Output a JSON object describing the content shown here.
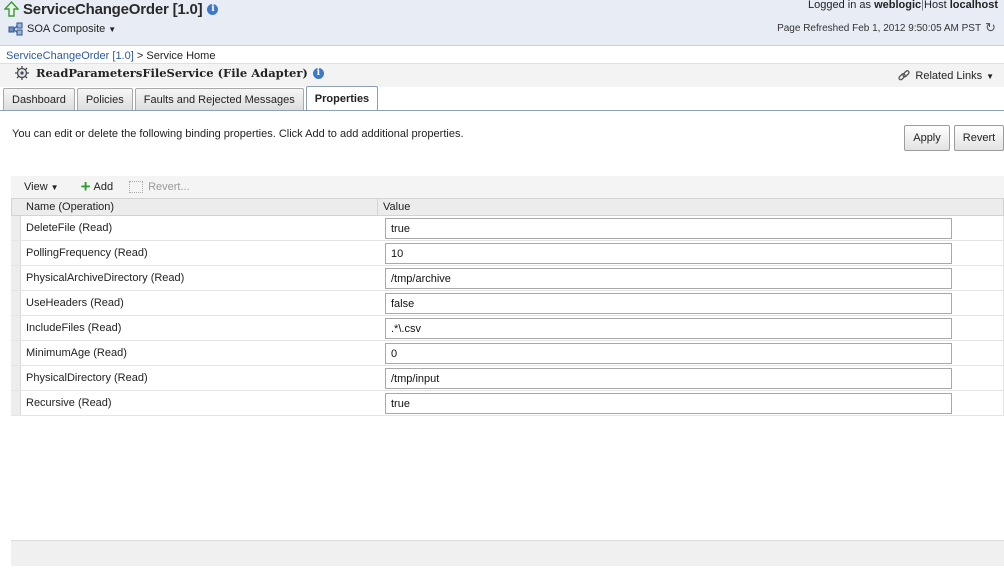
{
  "header": {
    "title": "ServiceChangeOrder [1.0]",
    "composite_menu": "SOA Composite",
    "logged_in_prefix": "Logged in as",
    "user": "weblogic",
    "host_label": "Host",
    "host": "localhost",
    "refresh_text": "Page Refreshed Feb 1, 2012 9:50:05 AM PST"
  },
  "breadcrumb": {
    "link": "ServiceChangeOrder [1.0]",
    "separator": ">",
    "current": "Service Home"
  },
  "service": {
    "title": "ReadParametersFileService (File Adapter)",
    "related_links": "Related Links"
  },
  "tabs": [
    {
      "label": "Dashboard"
    },
    {
      "label": "Policies"
    },
    {
      "label": "Faults and Rejected Messages"
    },
    {
      "label": "Properties"
    }
  ],
  "properties": {
    "description": "You can edit or delete the following binding properties. Click Add to add additional properties.",
    "apply_label": "Apply",
    "revert_label": "Revert",
    "toolbar": {
      "view": "View",
      "add": "Add",
      "revert": "Revert..."
    },
    "columns": [
      "Name (Operation)",
      "Value"
    ],
    "rows": [
      {
        "name": "DeleteFile (Read)",
        "value": "true"
      },
      {
        "name": "PollingFrequency (Read)",
        "value": "10"
      },
      {
        "name": "PhysicalArchiveDirectory (Read)",
        "value": "/tmp/archive"
      },
      {
        "name": "UseHeaders (Read)",
        "value": "false"
      },
      {
        "name": "IncludeFiles (Read)",
        "value": ".*\\.csv"
      },
      {
        "name": "MinimumAge (Read)",
        "value": "0"
      },
      {
        "name": "PhysicalDirectory (Read)",
        "value": "/tmp/input"
      },
      {
        "name": "Recursive (Read)",
        "value": "true"
      }
    ]
  },
  "colors": {
    "link": "#2d59a5",
    "header_bg": "#e8edf5",
    "add_icon": "#2f9e2f"
  }
}
